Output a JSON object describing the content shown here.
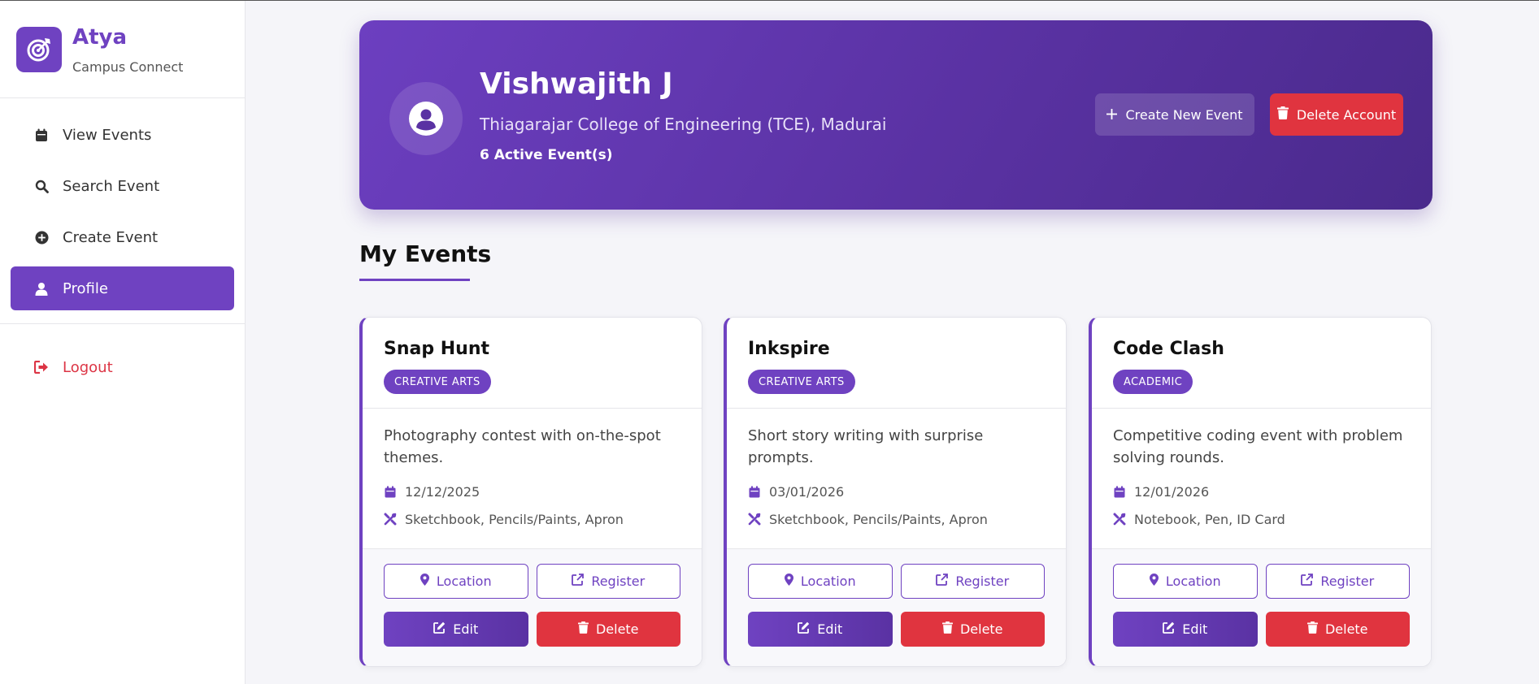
{
  "brand": {
    "name": "Atya",
    "subtitle": "Campus Connect"
  },
  "nav": {
    "items": [
      {
        "label": "View Events",
        "icon": "calendar-icon"
      },
      {
        "label": "Search Event",
        "icon": "search-icon"
      },
      {
        "label": "Create Event",
        "icon": "plus-circle-icon"
      },
      {
        "label": "Profile",
        "icon": "user-icon"
      }
    ],
    "logout": "Logout"
  },
  "profile": {
    "name": "Vishwajith J",
    "college": "Thiagarajar College of Engineering (TCE), Madurai",
    "active_events": "6 Active Event(s)",
    "create_label": "Create New Event",
    "delete_label": "Delete Account"
  },
  "section": {
    "title": "My Events"
  },
  "events": [
    {
      "title": "Snap Hunt",
      "category": "CREATIVE ARTS",
      "description": "Photography contest with on-the-spot themes.",
      "date": "12/12/2025",
      "requirements": "Sketchbook, Pencils/Paints, Apron"
    },
    {
      "title": "Inkspire",
      "category": "CREATIVE ARTS",
      "description": "Short story writing with surprise prompts.",
      "date": "03/01/2026",
      "requirements": "Sketchbook, Pencils/Paints, Apron"
    },
    {
      "title": "Code Clash",
      "category": "ACADEMIC",
      "description": "Competitive coding event with problem solving rounds.",
      "date": "12/01/2026",
      "requirements": "Notebook, Pen, ID Card"
    }
  ],
  "card_buttons": {
    "location": "Location",
    "register": "Register",
    "edit": "Edit",
    "delete": "Delete"
  },
  "colors": {
    "accent": "#6f42c1",
    "danger": "#e0343f"
  }
}
